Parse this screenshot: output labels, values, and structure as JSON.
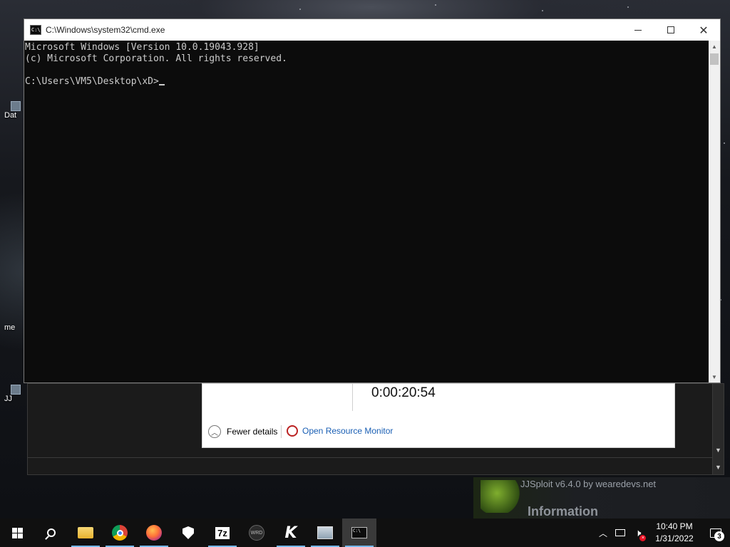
{
  "desktop": {
    "icons": [
      {
        "label": "Dat"
      },
      {
        "label": "me"
      },
      {
        "label": "JJ"
      }
    ]
  },
  "task_manager": {
    "uptime": "0:00:20:54",
    "fewer_details": "Fewer details",
    "open_resource_monitor": "Open Resource Monitor"
  },
  "jjsploit": {
    "title": "JJSploit v6.4.0 by wearedevs.net",
    "section": "Information"
  },
  "cmd": {
    "title": "C:\\Windows\\system32\\cmd.exe",
    "icon_text": "C:\\",
    "lines": [
      "Microsoft Windows [Version 10.0.19043.928]",
      "(c) Microsoft Corporation. All rights reserved.",
      "",
      "C:\\Users\\VM5\\Desktop\\xD>"
    ]
  },
  "taskbar": {
    "items": [
      {
        "name": "start",
        "icon": "windows-logo-icon"
      },
      {
        "name": "search",
        "icon": "search-icon"
      },
      {
        "name": "file-explorer",
        "icon": "folder-icon"
      },
      {
        "name": "chrome",
        "icon": "chrome-icon"
      },
      {
        "name": "firefox",
        "icon": "firefox-icon"
      },
      {
        "name": "security",
        "icon": "shield-icon"
      },
      {
        "name": "7zip",
        "icon": "7zip-icon",
        "text": "7z"
      },
      {
        "name": "wrd",
        "icon": "wrd-icon",
        "text": "WRD"
      },
      {
        "name": "k-app",
        "icon": "k-icon",
        "text": "K"
      },
      {
        "name": "image-app",
        "icon": "image-icon"
      },
      {
        "name": "cmd",
        "icon": "cmd-icon"
      }
    ],
    "clock_time": "10:40 PM",
    "clock_date": "1/31/2022",
    "notification_count": "3",
    "accent": "#76b9ed"
  }
}
